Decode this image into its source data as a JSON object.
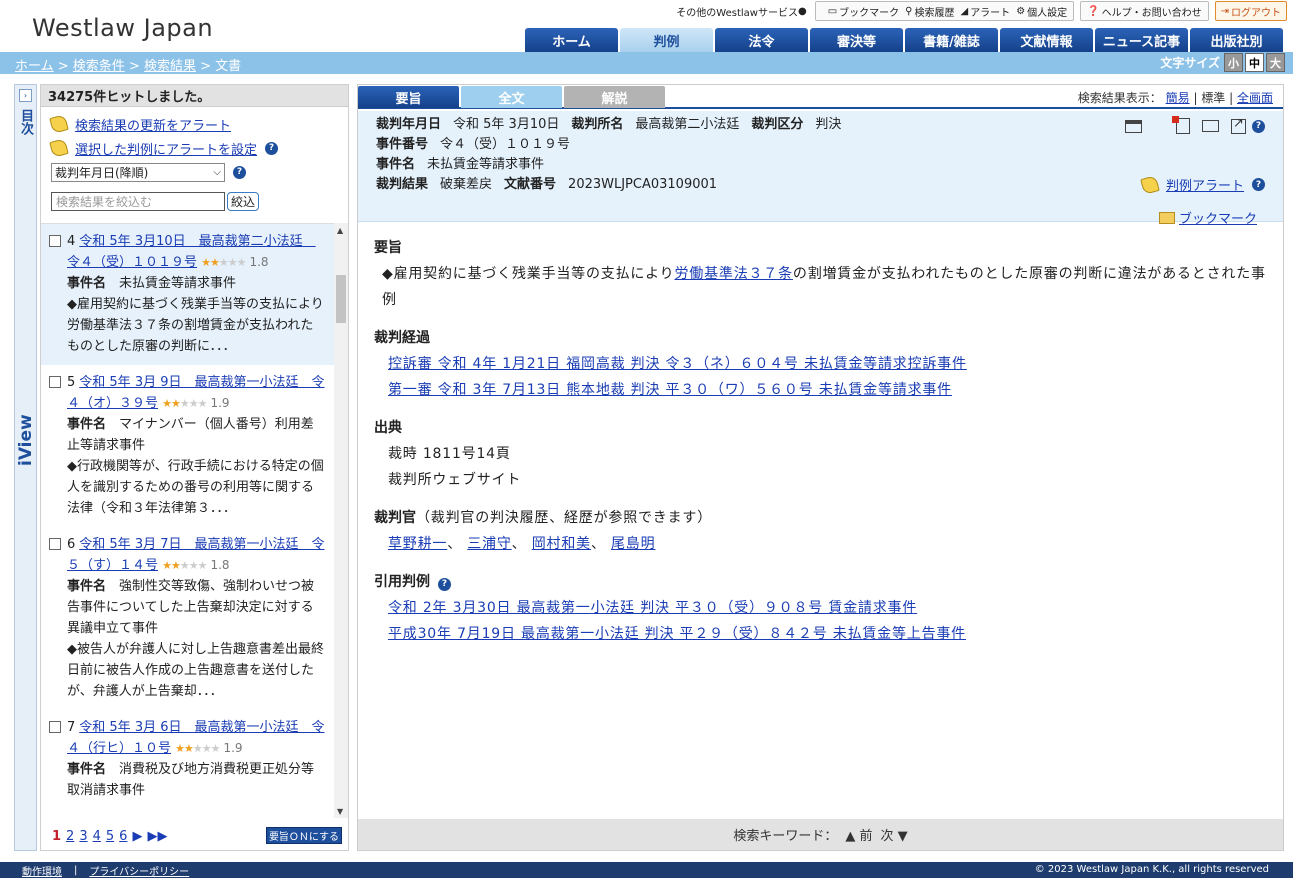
{
  "app": {
    "logo": "Westlaw Japan"
  },
  "utility": {
    "services": "その他のWestlawサービス",
    "bookmark": "ブックマーク",
    "history": "検索履歴",
    "alert": "アラート",
    "settings": "個人設定",
    "help": "ヘルプ・お問い合わせ",
    "logout": "ログアウト"
  },
  "nav_tabs": [
    {
      "label": "ホーム"
    },
    {
      "label": "判例"
    },
    {
      "label": "法令"
    },
    {
      "label": "審決等"
    },
    {
      "label": "書籍/雑誌"
    },
    {
      "label": "文献情報"
    },
    {
      "label": "ニュース記事"
    },
    {
      "label": "出版社別"
    }
  ],
  "breadcrumb": {
    "home": "ホーム",
    "sep": " > ",
    "cond": "検索条件",
    "results": "検索結果",
    "current": "文書"
  },
  "fontsize": {
    "label": "文字サイズ",
    "small": "小",
    "medium": "中",
    "large": "大"
  },
  "iview": {
    "toggle": "›",
    "mokuji": "目次",
    "label": "iView"
  },
  "left": {
    "hits": "34275件ヒットしました。",
    "alert_update": "検索結果の更新をアラート",
    "alert_selected": "選択した判例にアラートを設定",
    "sort_value": "裁判年月日(降順)",
    "filter_placeholder": "検索結果を絞込む",
    "filter_button": "絞込",
    "results": [
      {
        "num": "4",
        "title": "令和 5年 3月10日　最高裁第二小法廷　令４（受）１０１９号",
        "rating": "1.8",
        "case_label": "事件名",
        "case_name": "未払賃金等請求事件",
        "summary": "◆雇用契約に基づく残業手当等の支払により労働基準法３７条の割増賃金が支払われたものとした原審の判断に．．．"
      },
      {
        "num": "5",
        "title": "令和 5年 3月 9日　最高裁第一小法廷　令４（オ）３９号",
        "rating": "1.9",
        "case_label": "事件名",
        "case_name": "マイナンバー（個人番号）利用差止等請求事件",
        "summary": "◆行政機関等が、行政手続における特定の個人を識別するための番号の利用等に関する法律（令和３年法律第３．．．"
      },
      {
        "num": "6",
        "title": "令和 5年 3月 7日　最高裁第一小法廷　令５（す）１４号",
        "rating": "1.8",
        "case_label": "事件名",
        "case_name": "強制性交等致傷、強制わいせつ被告事件についてした上告棄却決定に対する異議申立て事件",
        "summary": "◆被告人が弁護人に対し上告趣意書差出最終日前に被告人作成の上告趣意書を送付したが、弁護人が上告棄却．．．"
      },
      {
        "num": "7",
        "title": "令和 5年 3月 6日　最高裁第一小法廷　令４（行ヒ）１０号",
        "rating": "1.9",
        "case_label": "事件名",
        "case_name": "消費税及び地方消費税更正処分等取消請求事件",
        "summary": ""
      }
    ],
    "pager": {
      "pages": [
        "1",
        "2",
        "3",
        "4",
        "5",
        "6"
      ],
      "next": "▶",
      "last": "▶▶",
      "toggle_label": "要旨ＯＮにする"
    }
  },
  "right": {
    "tabs": {
      "summary": "要旨",
      "full": "全文",
      "commentary": "解説"
    },
    "display": {
      "label": "検索結果表示：",
      "simple": "簡易",
      "standard": "標準",
      "full": "全画面"
    },
    "info": {
      "date_label": "裁判年月日",
      "date": "令和 5年 3月10日",
      "court_label": "裁判所名",
      "court": "最高裁第二小法廷",
      "type_label": "裁判区分",
      "type": "判決",
      "case_no_label": "事件番号",
      "case_no": "令４（受）１０１９号",
      "case_name_label": "事件名",
      "case_name": "未払賃金等請求事件",
      "result_label": "裁判結果",
      "result": "破棄差戻",
      "doc_no_label": "文献番号",
      "doc_no": "2023WLJPCA03109001"
    },
    "alert": "判例アラート",
    "bookmark": "ブックマーク",
    "sections": {
      "summary_title": "要旨",
      "summary_pre": "◆雇用契約に基づく残業手当等の支払により",
      "summary_link": "労働基準法３７条",
      "summary_post": "の割増賃金が支払われたものとした原審の判断に違法があるとされた事例",
      "history_title": "裁判経過",
      "history": [
        "控訴審 令和 4年 1月21日 福岡高裁 判決 令３（ネ）６０４号 未払賃金等請求控訴事件",
        "第一審 令和 3年 7月13日 熊本地裁 判決 平３０（ワ）５６０号 未払賃金等請求事件"
      ],
      "source_title": "出典",
      "sources": [
        "裁時 1811号14頁",
        "裁判所ウェブサイト"
      ],
      "judges_title": "裁判官",
      "judges_note": "（裁判官の判決履歴、経歴が参照できます）",
      "judges": [
        "草野耕一",
        "三浦守",
        "岡村和美",
        "尾島明"
      ],
      "cited_title": "引用判例",
      "cited": [
        "令和 2年 3月30日 最高裁第一小法廷 判決 平３０（受）９０８号 賃金請求事件",
        "平成30年 7月19日 最高裁第一小法廷 判決 平２９（受）８４２号 未払賃金等上告事件"
      ]
    },
    "keyword_bar": {
      "label": "検索キーワード：",
      "prev": "▲ 前",
      "next": "次 ▼"
    }
  },
  "footer": {
    "env": "動作環境",
    "sep": "|",
    "privacy": "プライバシーポリシー",
    "copyright": "© 2023 Westlaw Japan K.K., all rights reserved"
  }
}
